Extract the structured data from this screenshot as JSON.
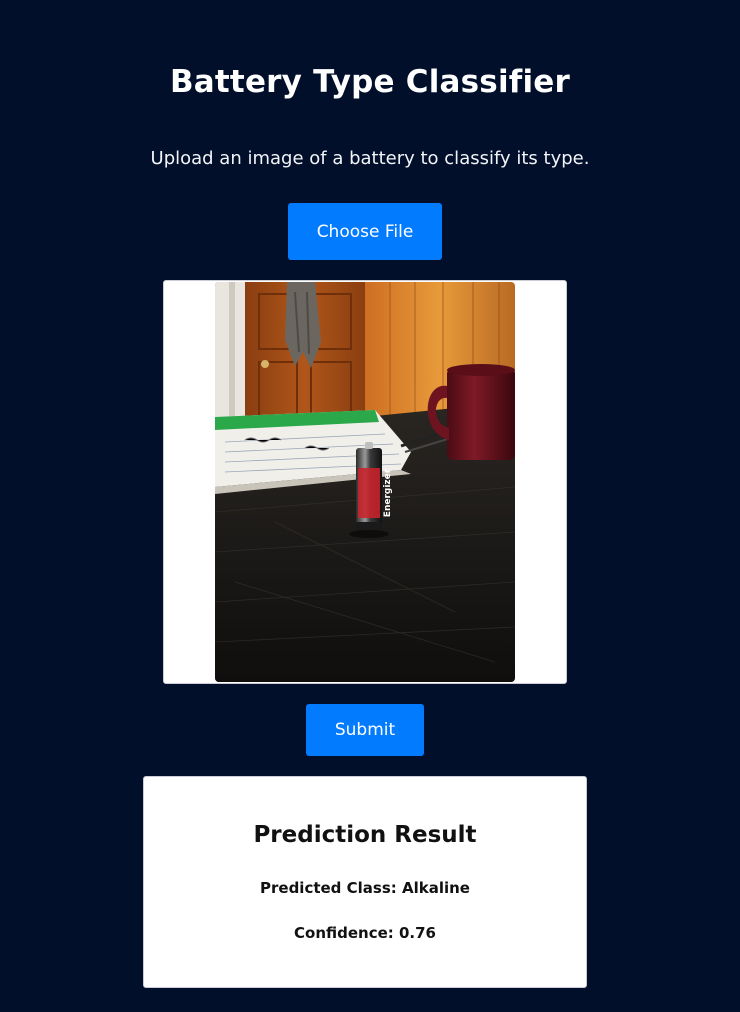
{
  "page": {
    "title": "Battery Type Classifier",
    "subtitle": "Upload an image of a battery to classify its type."
  },
  "upload": {
    "choose_file_label": "Choose File",
    "submit_label": "Submit",
    "preview_alt": "battery photo preview"
  },
  "result": {
    "heading": "Prediction Result",
    "predicted_class_text": "Predicted Class: Alkaline",
    "confidence_text": "Confidence: 0.76"
  },
  "colors": {
    "background": "#010f2b",
    "accent": "#027bff",
    "card": "#ffffff"
  }
}
